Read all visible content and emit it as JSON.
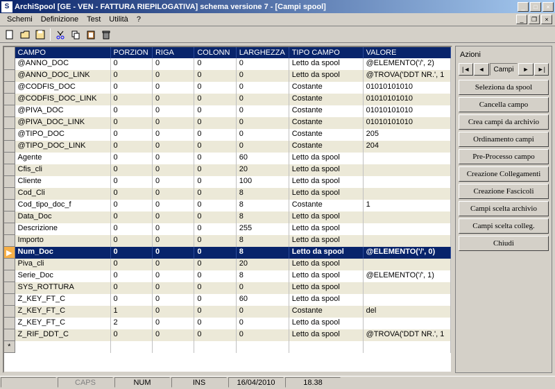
{
  "title": "ArchiSpool [GE - VEN - FATTURA RIEPILOGATIVA] schema versione 7 - [Campi spool]",
  "menu": {
    "schemi": "Schemi",
    "definizione": "Definizione",
    "test": "Test",
    "utilita": "Utilità",
    "help": "?"
  },
  "columns": {
    "campo": "CAMPO",
    "porzion": "PORZION",
    "riga": "RIGA",
    "colonn": "COLONN",
    "larghezza": "LARGHEZZA",
    "tipo": "TIPO CAMPO",
    "valore": "VALORE"
  },
  "rows": [
    {
      "campo": "@ANNO_DOC",
      "porz": "0",
      "riga": "0",
      "col": "0",
      "larg": "0",
      "tipo": "Letto da spool",
      "val": "@ELEMENTO('/', 2)"
    },
    {
      "campo": "@ANNO_DOC_LINK",
      "porz": "0",
      "riga": "0",
      "col": "0",
      "larg": "0",
      "tipo": "Letto da spool",
      "val": "@TROVA('DDT NR.', 1"
    },
    {
      "campo": "@CODFIS_DOC",
      "porz": "0",
      "riga": "0",
      "col": "0",
      "larg": "0",
      "tipo": "Costante",
      "val": "01010101010"
    },
    {
      "campo": "@CODFIS_DOC_LINK",
      "porz": "0",
      "riga": "0",
      "col": "0",
      "larg": "0",
      "tipo": "Costante",
      "val": "01010101010"
    },
    {
      "campo": "@PIVA_DOC",
      "porz": "0",
      "riga": "0",
      "col": "0",
      "larg": "0",
      "tipo": "Costante",
      "val": "01010101010"
    },
    {
      "campo": "@PIVA_DOC_LINK",
      "porz": "0",
      "riga": "0",
      "col": "0",
      "larg": "0",
      "tipo": "Costante",
      "val": "01010101010"
    },
    {
      "campo": "@TIPO_DOC",
      "porz": "0",
      "riga": "0",
      "col": "0",
      "larg": "0",
      "tipo": "Costante",
      "val": "205"
    },
    {
      "campo": "@TIPO_DOC_LINK",
      "porz": "0",
      "riga": "0",
      "col": "0",
      "larg": "0",
      "tipo": "Costante",
      "val": "204"
    },
    {
      "campo": "Agente",
      "porz": "0",
      "riga": "0",
      "col": "0",
      "larg": "60",
      "tipo": "Letto da spool",
      "val": ""
    },
    {
      "campo": "Cfis_cli",
      "porz": "0",
      "riga": "0",
      "col": "0",
      "larg": "20",
      "tipo": "Letto da spool",
      "val": ""
    },
    {
      "campo": "Cliente",
      "porz": "0",
      "riga": "0",
      "col": "0",
      "larg": "100",
      "tipo": "Letto da spool",
      "val": ""
    },
    {
      "campo": "Cod_Cli",
      "porz": "0",
      "riga": "0",
      "col": "0",
      "larg": "8",
      "tipo": "Letto da spool",
      "val": ""
    },
    {
      "campo": "Cod_tipo_doc_f",
      "porz": "0",
      "riga": "0",
      "col": "0",
      "larg": "8",
      "tipo": "Costante",
      "val": "1"
    },
    {
      "campo": "Data_Doc",
      "porz": "0",
      "riga": "0",
      "col": "0",
      "larg": "8",
      "tipo": "Letto da spool",
      "val": ""
    },
    {
      "campo": "Descrizione",
      "porz": "0",
      "riga": "0",
      "col": "0",
      "larg": "255",
      "tipo": "Letto da spool",
      "val": ""
    },
    {
      "campo": "Importo",
      "porz": "0",
      "riga": "0",
      "col": "0",
      "larg": "8",
      "tipo": "Letto da spool",
      "val": ""
    },
    {
      "campo": "Num_Doc",
      "porz": "0",
      "riga": "0",
      "col": "0",
      "larg": "8",
      "tipo": "Letto da spool",
      "val": "@ELEMENTO('/', 0)",
      "selected": true
    },
    {
      "campo": "Piva_cli",
      "porz": "0",
      "riga": "0",
      "col": "0",
      "larg": "20",
      "tipo": "Letto da spool",
      "val": ""
    },
    {
      "campo": "Serie_Doc",
      "porz": "0",
      "riga": "0",
      "col": "0",
      "larg": "8",
      "tipo": "Letto da spool",
      "val": "@ELEMENTO('/', 1)"
    },
    {
      "campo": "SYS_ROTTURA",
      "porz": "0",
      "riga": "0",
      "col": "0",
      "larg": "0",
      "tipo": "Letto da spool",
      "val": ""
    },
    {
      "campo": "Z_KEY_FT_C",
      "porz": "0",
      "riga": "0",
      "col": "0",
      "larg": "60",
      "tipo": "Letto da spool",
      "val": ""
    },
    {
      "campo": "Z_KEY_FT_C",
      "porz": "1",
      "riga": "0",
      "col": "0",
      "larg": "0",
      "tipo": "Costante",
      "val": "del"
    },
    {
      "campo": "Z_KEY_FT_C",
      "porz": "2",
      "riga": "0",
      "col": "0",
      "larg": "0",
      "tipo": "Letto da spool",
      "val": ""
    },
    {
      "campo": "Z_RIF_DDT_C",
      "porz": "0",
      "riga": "0",
      "col": "0",
      "larg": "0",
      "tipo": "Letto da spool",
      "val": "@TROVA('DDT NR.', 1"
    }
  ],
  "side": {
    "title": "Azioni",
    "nav_label": "Campi",
    "buttons": [
      "Seleziona da spool",
      "Cancella campo",
      "Crea campi da archivio",
      "Ordinamento campi",
      "Pre-Processo campo",
      "Creazione Collegamenti",
      "Creazione Fascicoli",
      "Campi scelta archivio",
      "Campi scelta colleg.",
      "Chiudi"
    ]
  },
  "status": {
    "caps": "CAPS",
    "num": "NUM",
    "ins": "INS",
    "date": "16/04/2010",
    "time": "18.38"
  }
}
